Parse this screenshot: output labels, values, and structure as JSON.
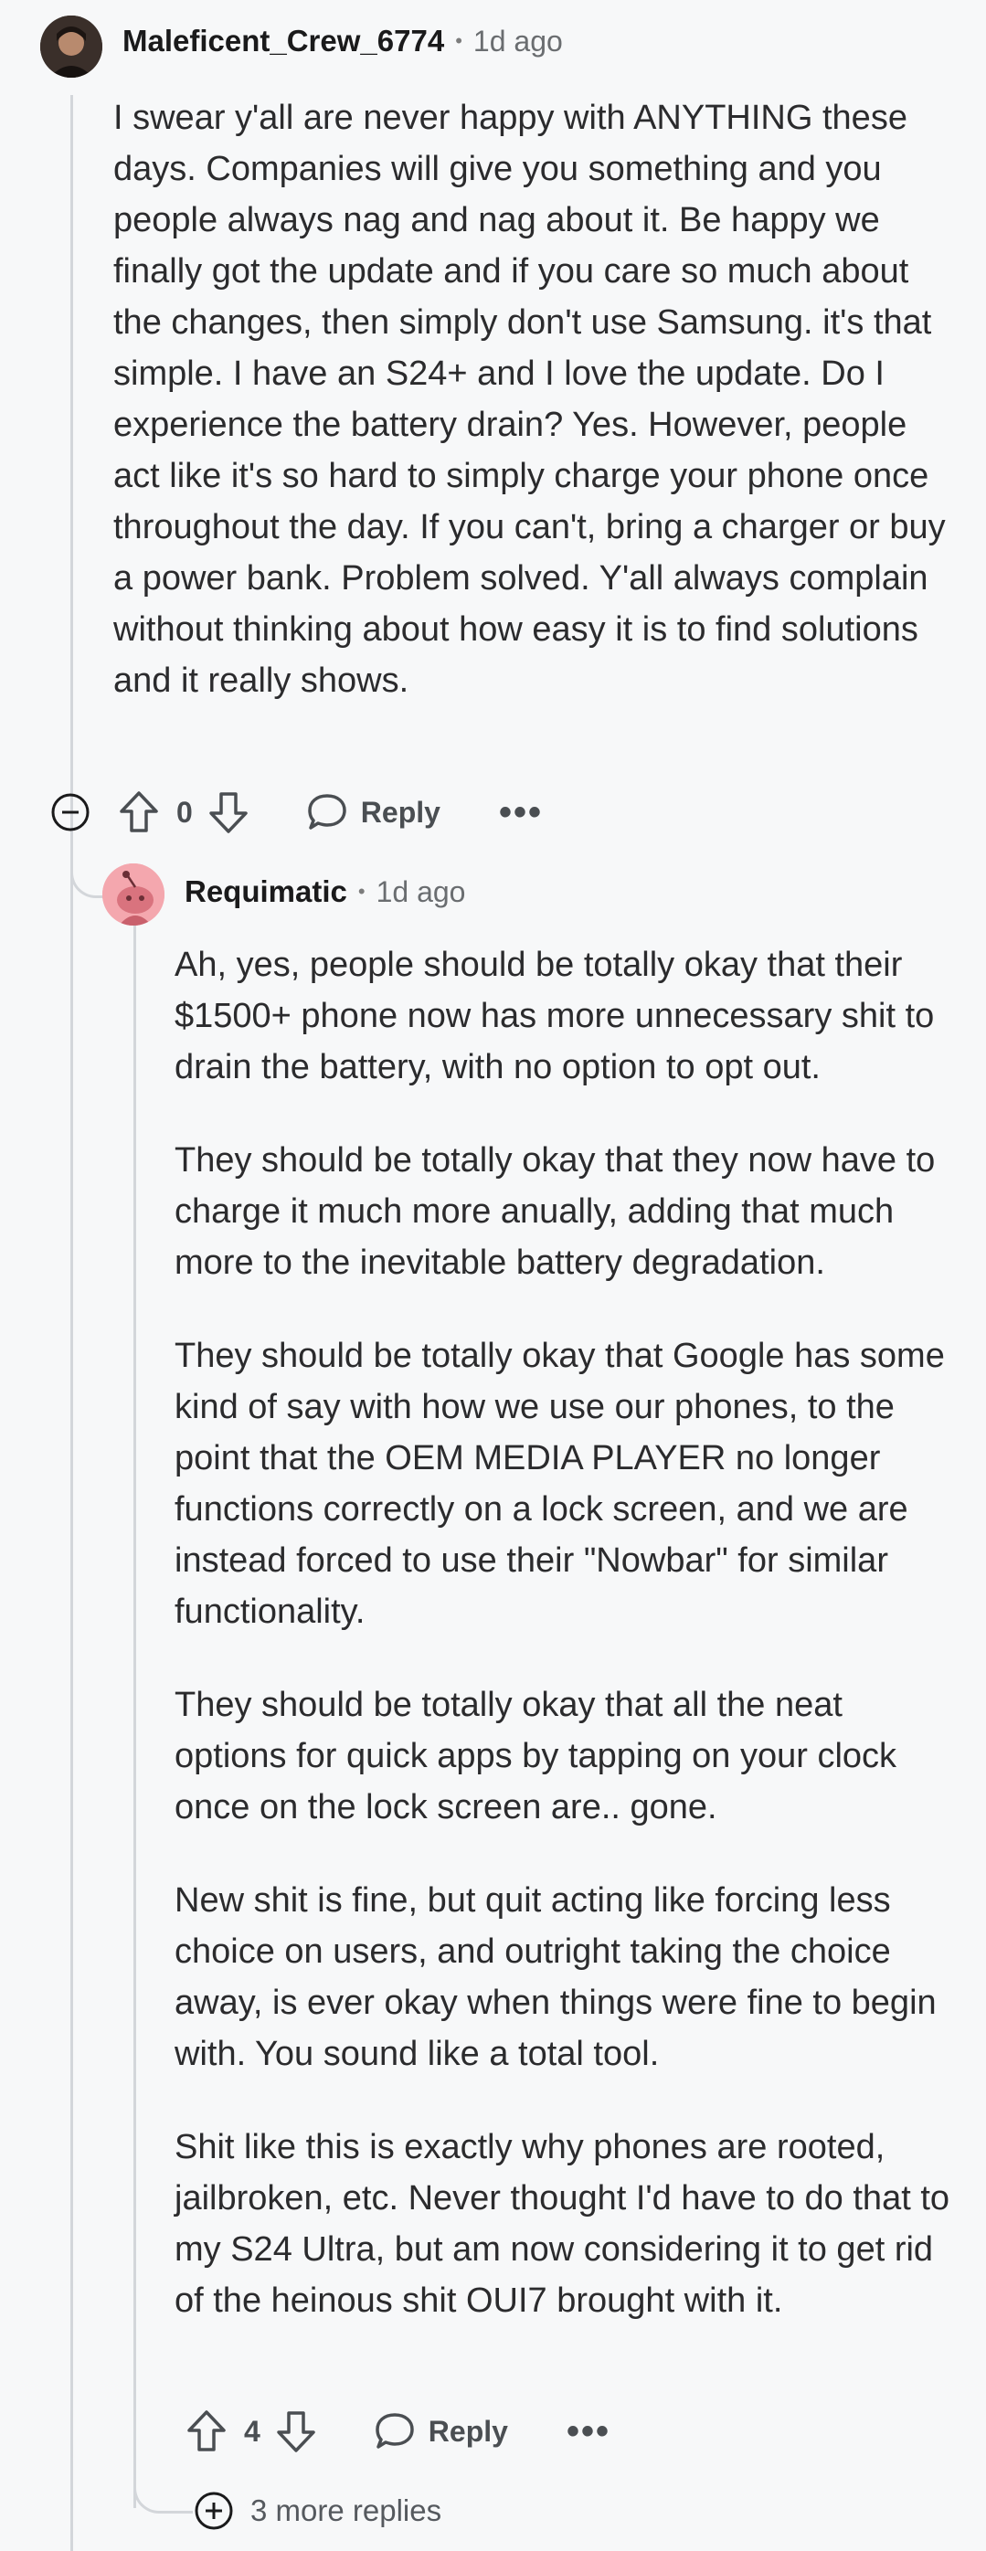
{
  "comment": {
    "username": "Maleficent_Crew_6774",
    "separator": "•",
    "time": "1d ago",
    "body": [
      "I swear y'all are never happy with ANYTHING these days. Companies will give you something and you people always nag and nag about it. Be happy we finally got the update and if you care so much about the changes, then simply don't use Samsung. it's that simple. I have an S24+ and I love the update. Do I experience the battery drain? Yes. However, people act like it's so hard to simply charge your phone once throughout the day. If you can't, bring a charger or buy a power bank. Problem solved. Y'all always complain without thinking about how easy it is to find solutions and it really shows."
    ],
    "score": "0",
    "reply_label": "Reply",
    "more_label": "•••"
  },
  "reply": {
    "username": "Requimatic",
    "separator": "•",
    "time": "1d ago",
    "body": [
      "Ah, yes, people should be totally okay that their $1500+ phone now has more unnecessary shit to drain the battery, with no option to opt out.",
      "They should be totally okay that they now have to charge it much more anually, adding that much more to the inevitable battery degradation.",
      "They should be totally okay that Google has some kind of say with how we use our phones, to the point that the OEM MEDIA PLAYER no longer functions correctly on a lock screen, and we are instead forced to use their \"Nowbar\" for similar functionality.",
      "They should be totally okay that all the neat options for quick apps by tapping on your clock once on the lock screen are.. gone.",
      "New shit is fine, but quit acting like forcing less choice on users, and outright taking the choice away, is ever okay when things were fine to begin with. You sound like a total tool.",
      "Shit like this is exactly why phones are rooted, jailbroken, etc. Never thought I'd have to do that to my S24 Ultra, but am now considering it to get rid of the heinous shit OUI7 brought with it."
    ],
    "score": "4",
    "reply_label": "Reply",
    "more_label": "•••",
    "more_replies": "3 more replies"
  },
  "colors": {
    "background": "#f7f8f9",
    "thread_line": "#d3d6da",
    "text": "#2b2b2d",
    "meta": "#6a6d70",
    "snoo_bg": "#f4a7ae"
  }
}
